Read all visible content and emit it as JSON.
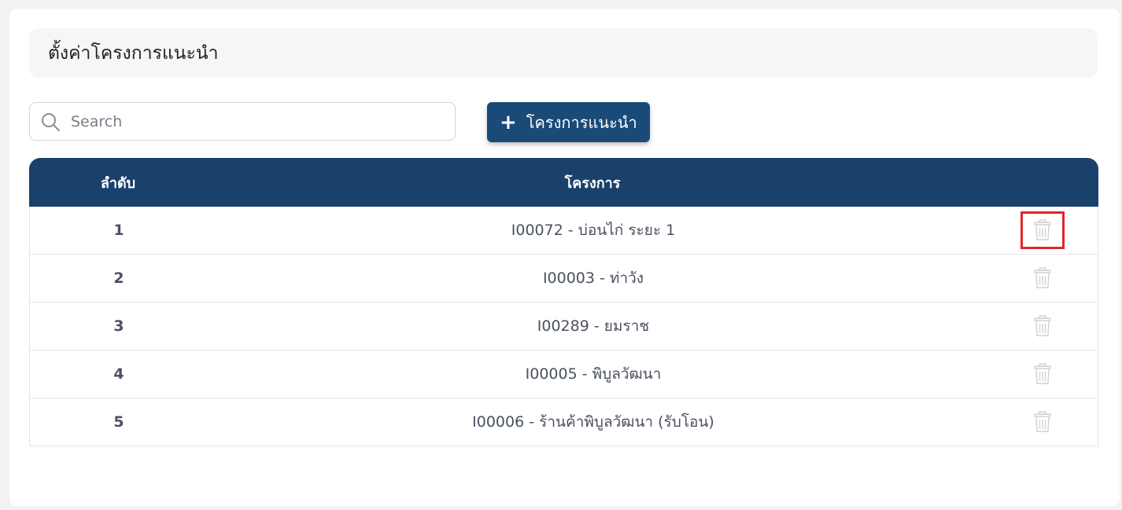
{
  "page": {
    "title": "ตั้งค่าโครงการแนะนำ"
  },
  "search": {
    "placeholder": "Search",
    "value": "",
    "icon": "search-icon"
  },
  "toolbar": {
    "add_label": "โครงการแนะนำ",
    "add_icon": "plus-icon"
  },
  "table": {
    "headers": {
      "no": "ลำดับ",
      "project": "โครงการ"
    },
    "rows": [
      {
        "no": "1",
        "project": "I00072 - บ่อนไก่ ระยะ 1",
        "delete_icon": "trash-icon",
        "highlighted": true
      },
      {
        "no": "2",
        "project": "I00003 - ท่าวัง",
        "delete_icon": "trash-icon",
        "highlighted": false
      },
      {
        "no": "3",
        "project": "I00289 - ยมราช",
        "delete_icon": "trash-icon",
        "highlighted": false
      },
      {
        "no": "4",
        "project": "I00005 - พิบูลวัฒนา",
        "delete_icon": "trash-icon",
        "highlighted": false
      },
      {
        "no": "5",
        "project": "I00006 - ร้านค้าพิบูลวัฒนา (รับโอน)",
        "delete_icon": "trash-icon",
        "highlighted": false
      }
    ]
  },
  "colors": {
    "header_bg": "#1a416b",
    "button_bg": "#1a4a78",
    "highlight": "#e0252a",
    "trash_icon": "#cfd2d6"
  }
}
